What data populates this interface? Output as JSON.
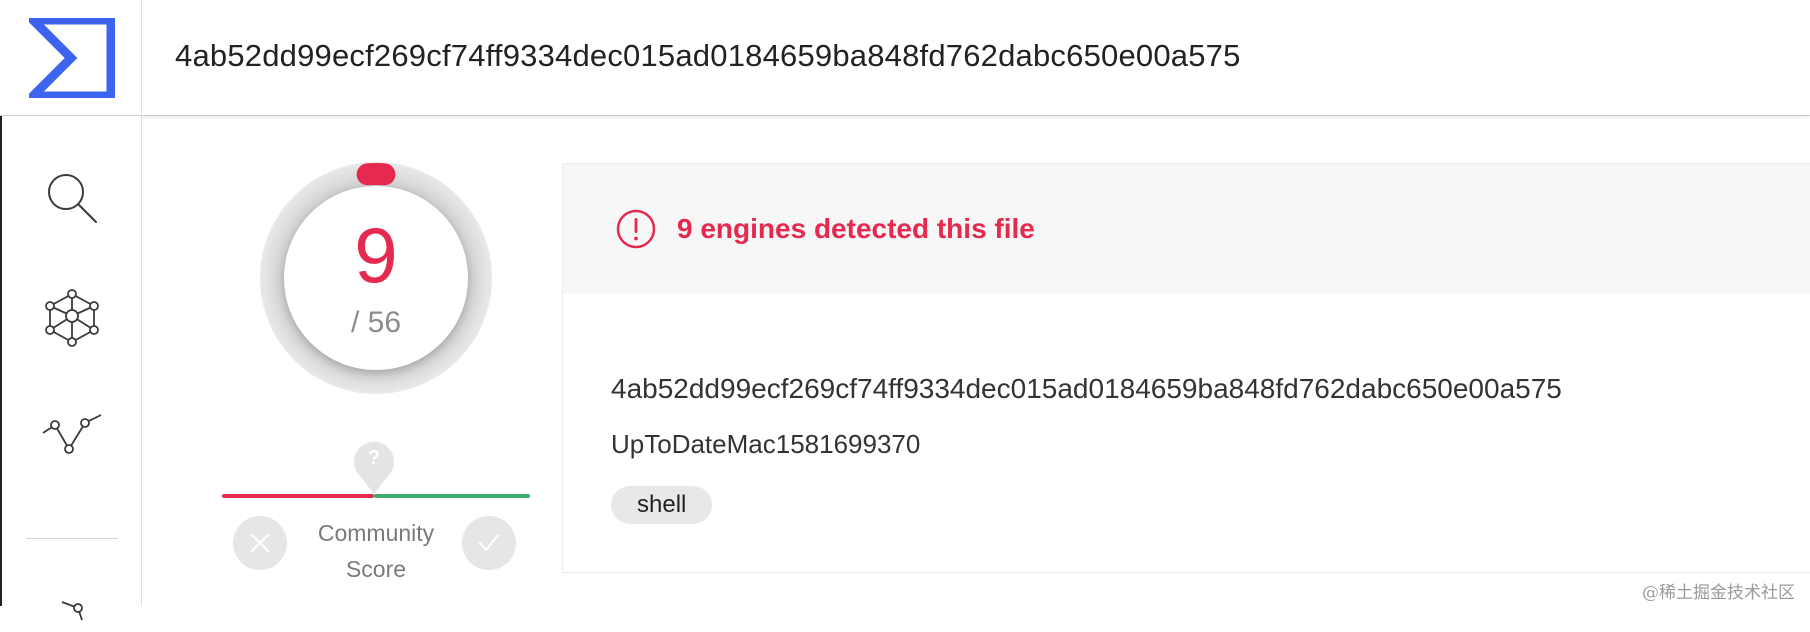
{
  "app": {
    "logo_icon": "sigma-logo-icon",
    "brand_color": "#3c64f0",
    "file_hash_title": "4ab52dd99ecf269cf74ff9334dec015ad0184659ba848fd762dabc650e00a575"
  },
  "sidebar": {
    "items": [
      {
        "icon": "search-icon"
      },
      {
        "icon": "relations-graph-icon"
      },
      {
        "icon": "trend-chart-icon"
      },
      {
        "icon": "partial-icon"
      }
    ]
  },
  "detection": {
    "detected": "9",
    "total": "/ 56",
    "detected_count": 9,
    "total_count": 56,
    "accent_color": "#e5294f"
  },
  "community": {
    "label_line1": "Community",
    "label_line2": "Score",
    "marker_text": "?",
    "negative_icon": "close-icon",
    "positive_icon": "check-icon",
    "negative_color": "#e5294f",
    "positive_color": "#3dab6e"
  },
  "summary": {
    "alert_text": "9 engines detected this file",
    "alert_icon": "exclamation-circle-icon",
    "file_hash": "4ab52dd99ecf269cf74ff9334dec015ad0184659ba848fd762dabc650e00a575",
    "file_name": "UpToDateMac1581699370",
    "tags": [
      "shell"
    ]
  },
  "watermark": "@稀土掘金技术社区"
}
